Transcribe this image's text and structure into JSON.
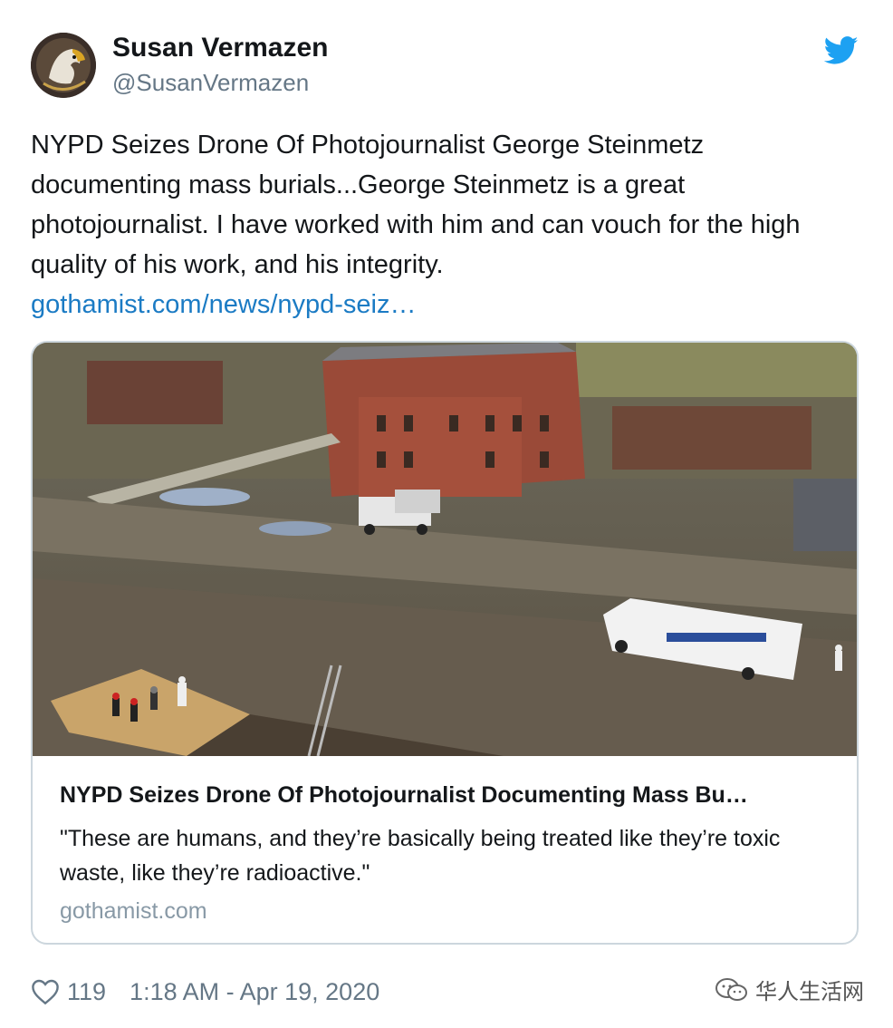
{
  "author": {
    "name": "Susan Vermazen",
    "handle": "@SusanVermazen"
  },
  "tweet": {
    "text": "NYPD Seizes Drone Of Photojournalist George Steinmetz documenting mass burials...George Steinmetz is a great photojournalist. I have worked with him and can vouch for the high quality of his work, and his integrity.",
    "link": "gothamist.com/news/nypd-seiz…"
  },
  "card": {
    "title": "NYPD Seizes Drone Of Photojournalist Documenting Mass Bu…",
    "description": "\"These are humans, and they’re basically being treated like they’re toxic waste, like they’re radioactive.\"",
    "domain": "gothamist.com",
    "image_icon": "aerial-photo-burial-site"
  },
  "footer": {
    "likes": "119",
    "timestamp": "1:18 AM - Apr 19, 2020"
  },
  "watermark": {
    "text": "华人生活网",
    "icon": "wechat-icon"
  },
  "colors": {
    "link": "#1b7bc4",
    "twitter_blue": "#1da1f2",
    "secondary_text": "#657786",
    "card_border": "#ccd6dd"
  }
}
